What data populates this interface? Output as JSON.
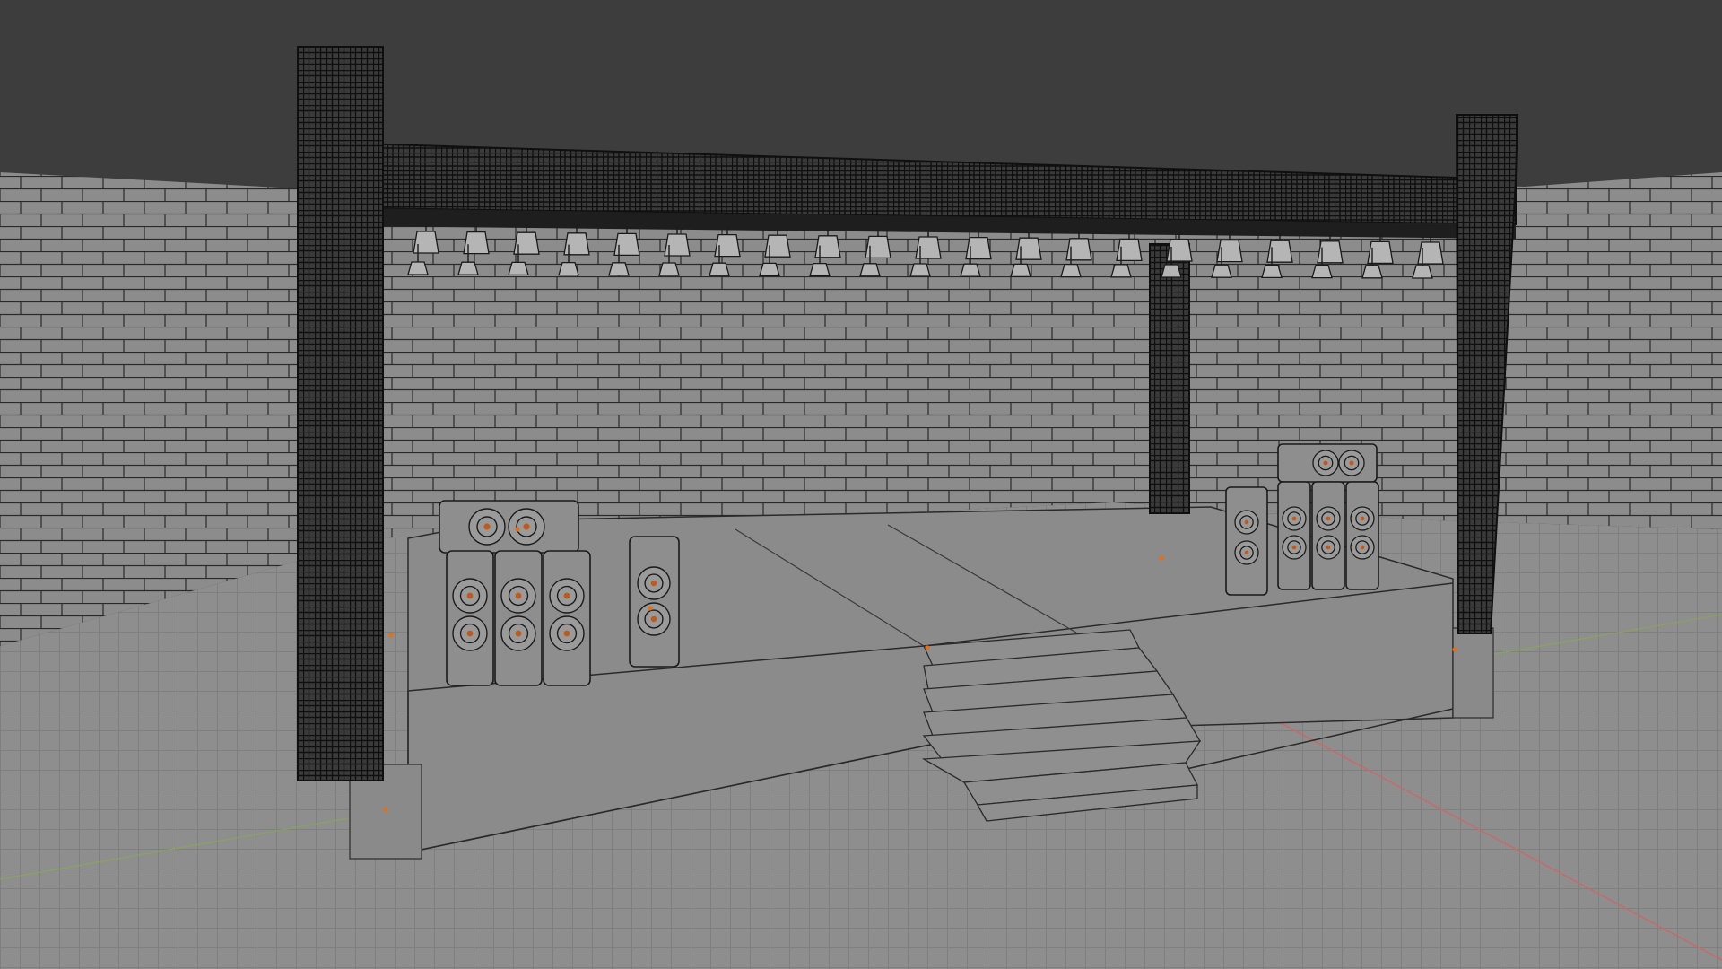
{
  "viewport": {
    "label": "",
    "shading": "solid",
    "overlay": "wireframe"
  },
  "scene": {
    "objects": [
      "wall",
      "floor-grid",
      "stage-platform",
      "stage-steps",
      "truss-left-pillar",
      "truss-right-pillar",
      "truss-back-pillar",
      "truss-top-beam",
      "stage-light",
      "speaker-stack-left",
      "speaker-left-single",
      "speaker-stack-right",
      "speaker-right-single"
    ],
    "stage_light_count": 42,
    "colors": {
      "background": "#3d3d3d",
      "wall": "#8a8a8a",
      "wire": "#1a1a1a",
      "floor": "#8e8e8e",
      "grid_line": "#7b7b7b",
      "x_axis": "#c76a6a",
      "y_axis": "#8aa35c",
      "origin_point": "#e0701c"
    }
  }
}
